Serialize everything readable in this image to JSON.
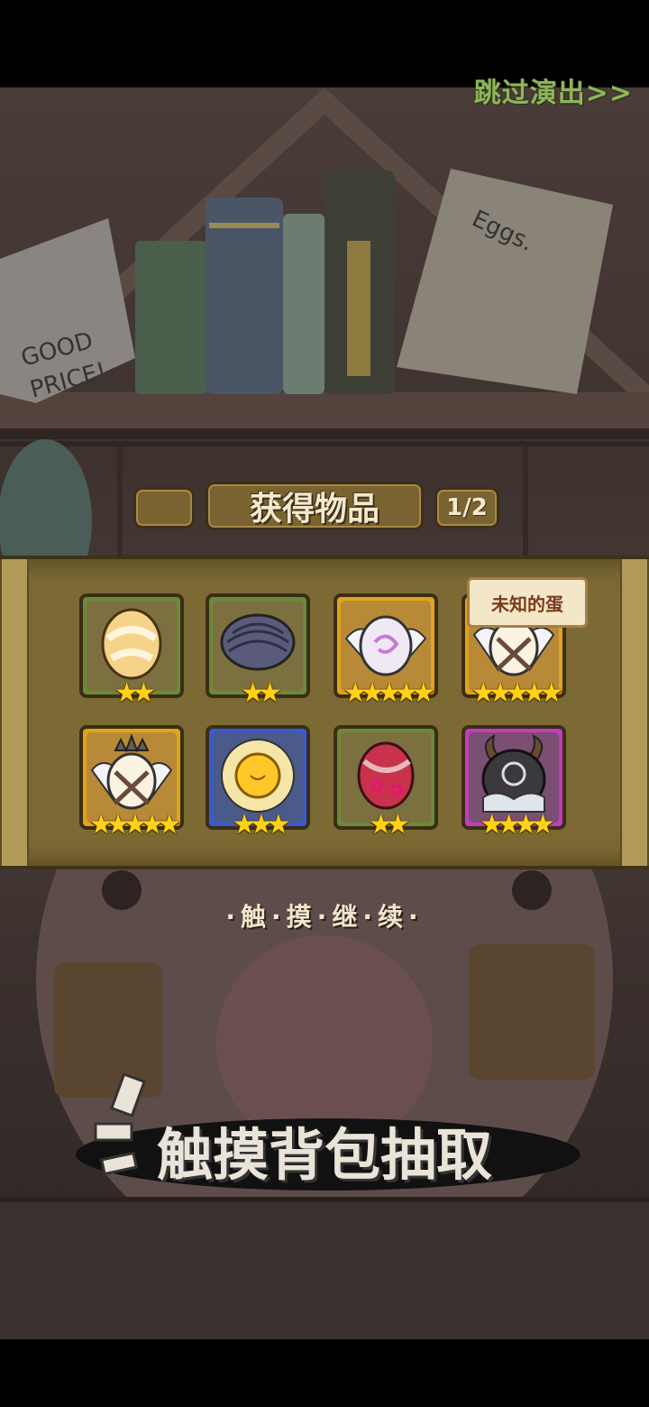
{
  "skip_label": "跳过演出>>",
  "header": {
    "title": "获得物品",
    "page": "1/2"
  },
  "tooltip": "未知的蛋",
  "items": [
    {
      "name": "white-orange-egg",
      "rarity": "green",
      "stars": 2,
      "stars_text": "★★"
    },
    {
      "name": "dark-shell-egg",
      "rarity": "green",
      "stars": 2,
      "stars_text": "★★"
    },
    {
      "name": "winged-pearl-egg",
      "rarity": "gold",
      "stars": 5,
      "stars_text": "★★★★★"
    },
    {
      "name": "unknown-winged-egg",
      "rarity": "gold",
      "stars": 5,
      "stars_text": "★★★★★"
    },
    {
      "name": "crowned-winged-egg",
      "rarity": "gold",
      "stars": 5,
      "stars_text": "★★★★★"
    },
    {
      "name": "sun-egg",
      "rarity": "blue",
      "stars": 3,
      "stars_text": "★★★"
    },
    {
      "name": "red-swirl-egg",
      "rarity": "green",
      "stars": 2,
      "stars_text": "★★"
    },
    {
      "name": "horned-dark-egg",
      "rarity": "purple",
      "stars": 4,
      "stars_text": "★★★★"
    }
  ],
  "touch_continue": "·触·摸·继·续·",
  "bottom_prompt": "触摸背包抽取",
  "colors": {
    "skip": "#8fb55a",
    "star": "#ffd21a",
    "panel": "#7c6a34"
  }
}
